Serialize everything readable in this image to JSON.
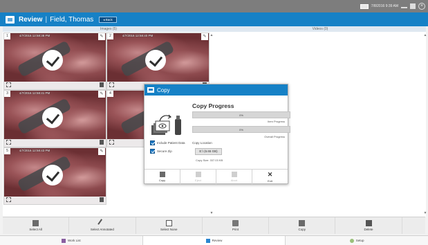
{
  "system": {
    "date_time": "7/8/2016  9:39 AM"
  },
  "header": {
    "title": "Review",
    "separator": "|",
    "patient": "Field, Thomas",
    "back_label": "◂ Back"
  },
  "sections": {
    "images": "Images (5)",
    "videos": "Videos (0)"
  },
  "tiles": [
    {
      "number": "1",
      "timestamp": "4/7/2016 12:58:38 PM",
      "selected": true
    },
    {
      "number": "2",
      "timestamp": "4/7/2016 12:58:40 PM",
      "selected": true
    },
    {
      "number": "3",
      "timestamp": "4/7/2016 12:58:41 PM",
      "selected": true
    },
    {
      "number": "4",
      "timestamp": "",
      "selected": true
    },
    {
      "number": "5",
      "timestamp": "4/7/2016 12:58:43 PM",
      "selected": true
    }
  ],
  "dialog": {
    "title": "Copy",
    "heading": "Copy Progress",
    "item_progress": {
      "value": "0%",
      "fraction": 0,
      "label": "Item Progress"
    },
    "overall_progress": {
      "value": "0%",
      "fraction": 0,
      "label": "Overall Progress"
    },
    "include_patient_data": {
      "label": "Include Patient Data",
      "checked": true
    },
    "secure_zip": {
      "label": "Secure Zip",
      "checked": true
    },
    "copy_location_label": "Copy Location",
    "copy_location_value": "E:\\ (6.65 GB)",
    "copy_size": "Copy Size: 337.03 KB",
    "buttons": [
      {
        "label": "Copy",
        "enabled": true
      },
      {
        "label": "Eject",
        "enabled": false
      },
      {
        "label": "Abort",
        "enabled": false
      },
      {
        "label": "Exit",
        "enabled": true
      }
    ]
  },
  "toolbar": {
    "select_all": "Select All",
    "select_annotated": "Select Annotated",
    "select_none": "Select None",
    "print": "Print",
    "copy": "Copy",
    "delete": "Delete"
  },
  "nav": {
    "worklist": "Work List",
    "review": "Review",
    "setup": "Setup"
  },
  "colors": {
    "accent": "#1681c6",
    "checkbox": "#1a76c1"
  }
}
